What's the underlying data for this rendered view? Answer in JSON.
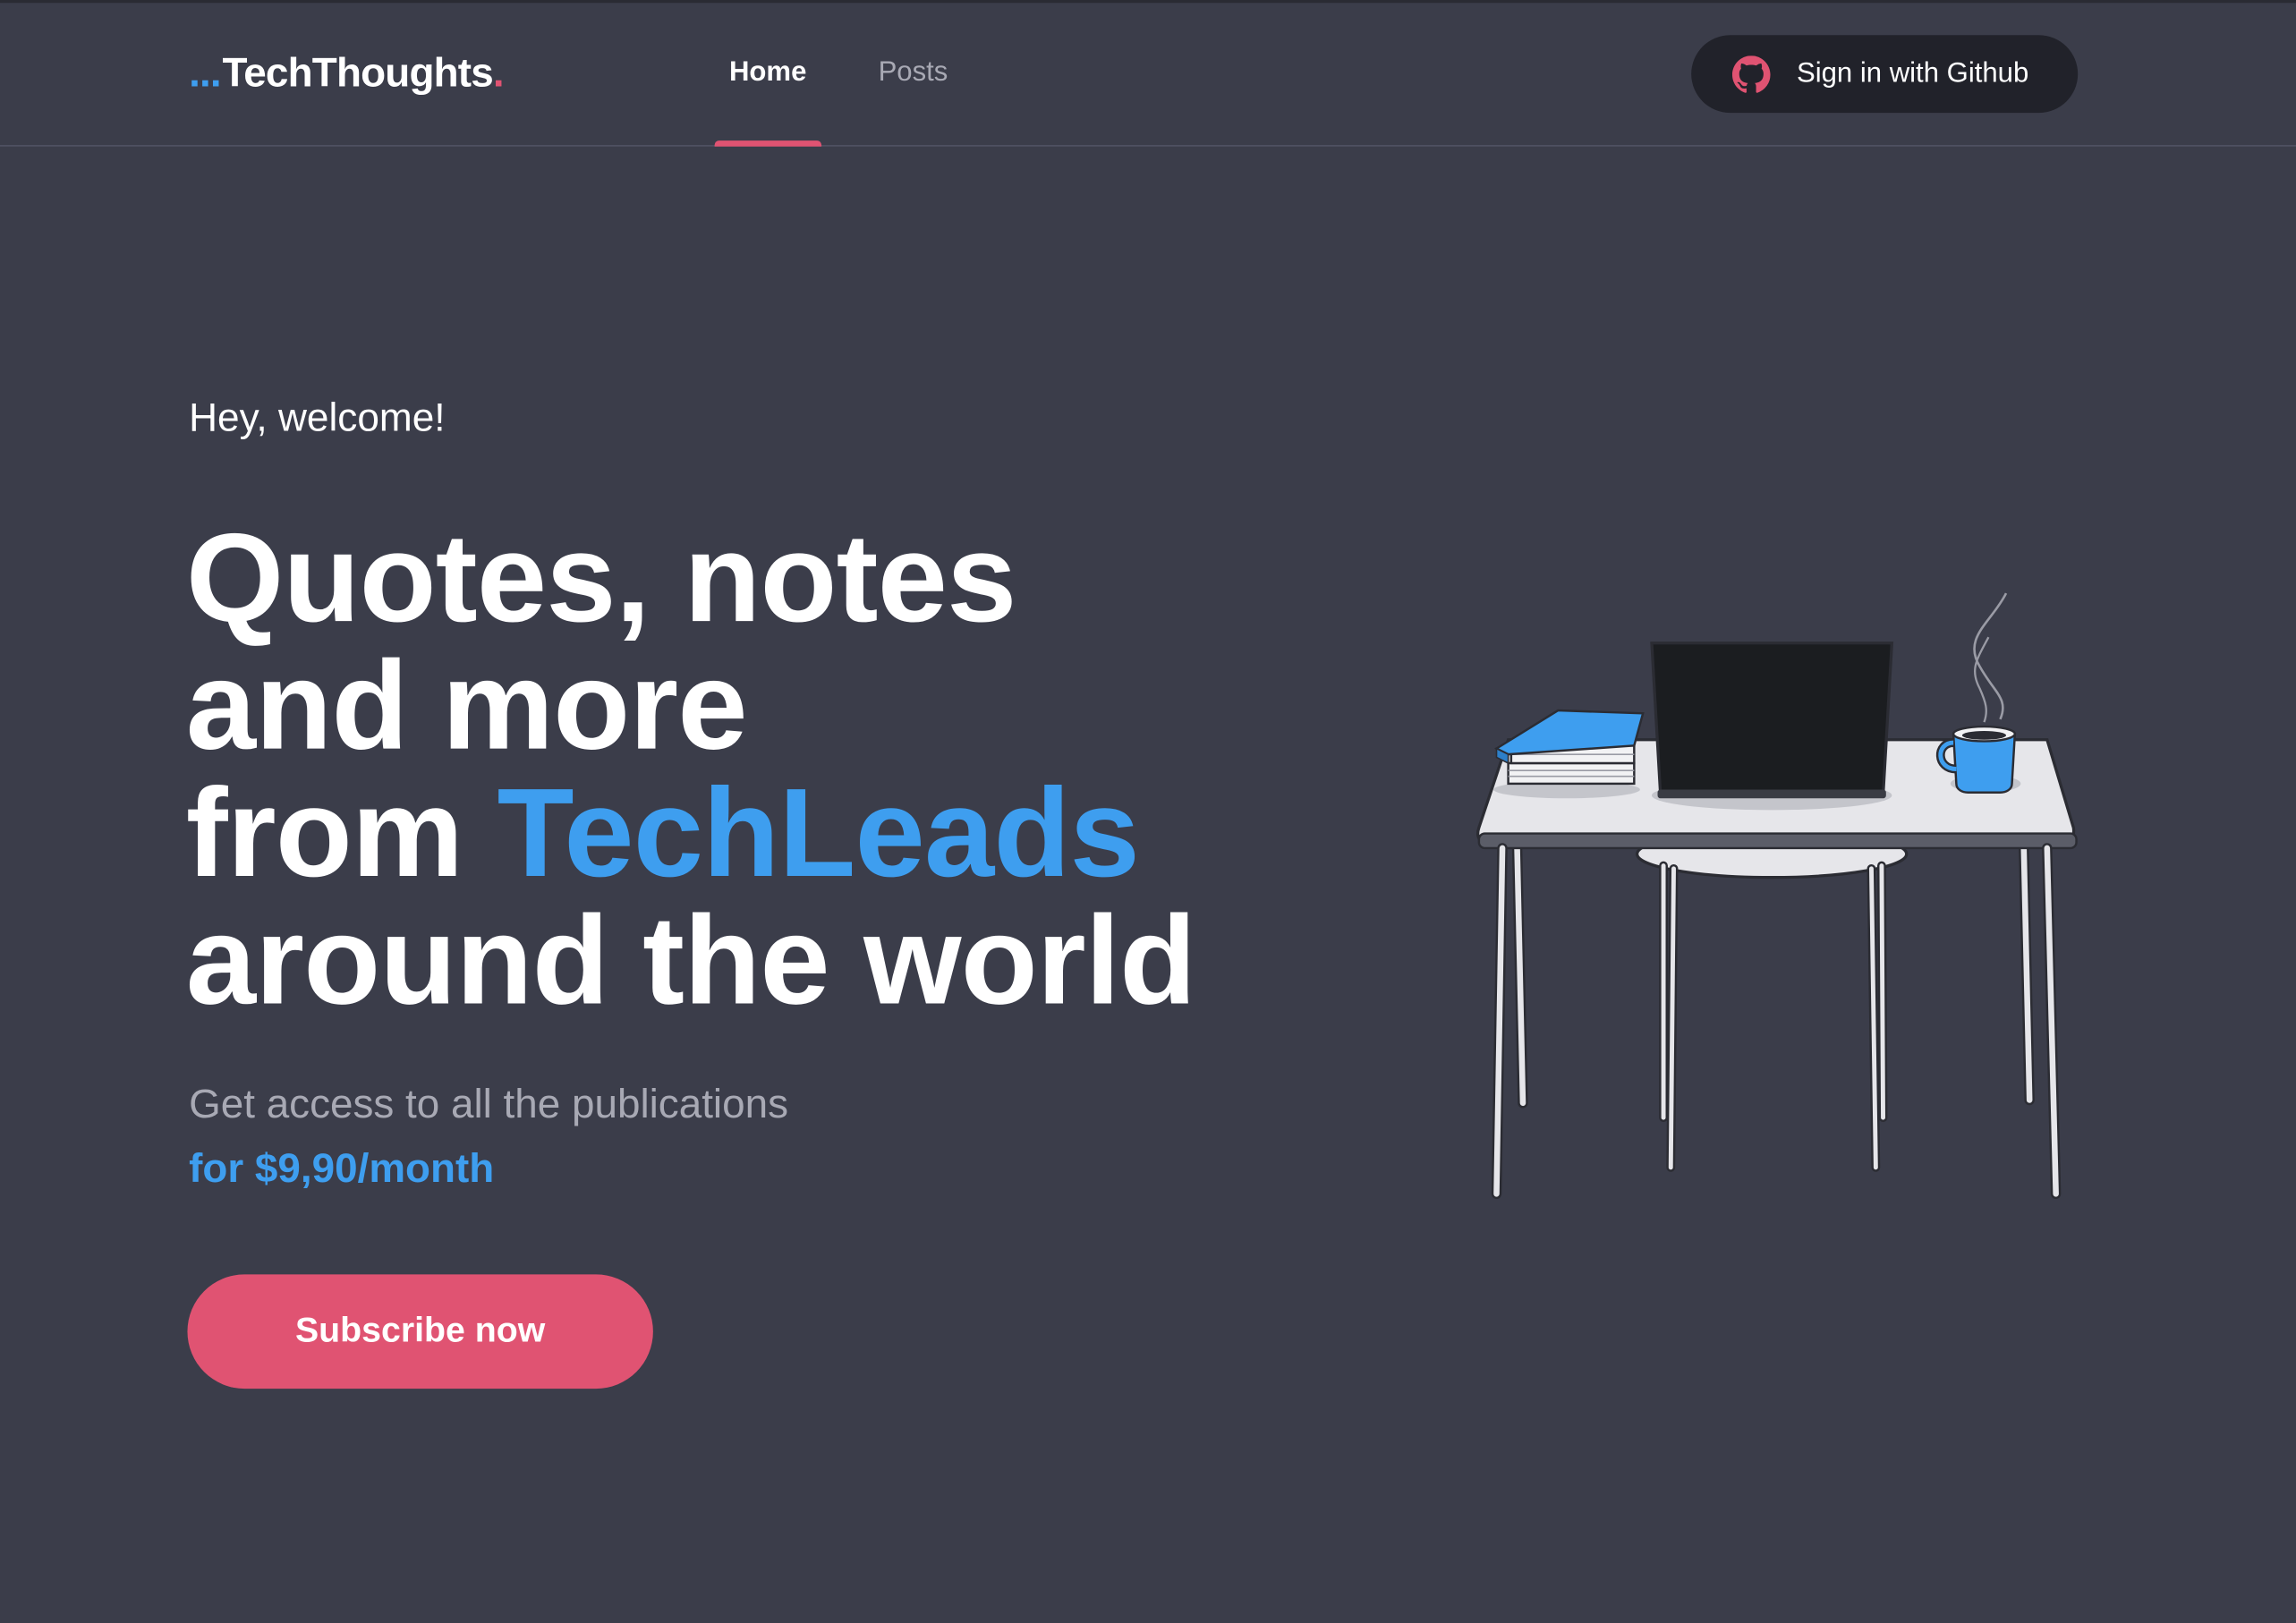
{
  "brand": {
    "prefix_dots": "...",
    "name": "TechThoughts",
    "suffix_dot": ".",
    "accent_color": "#3e9eef",
    "dot_color": "#e05372"
  },
  "nav": {
    "items": [
      {
        "label": "Home",
        "active": true
      },
      {
        "label": "Posts",
        "active": false
      }
    ]
  },
  "signin": {
    "label": "Sign in with Github",
    "icon": "github-icon"
  },
  "hero": {
    "greeting": "Hey, welcome!",
    "headline_line1": "Quotes, notes",
    "headline_line2": "and more",
    "headline_line3_prefix": "from ",
    "headline_line3_accent": "TechLeads",
    "headline_line4": "around the world",
    "subtitle": "Get access to all the publications",
    "price": "for $9,90/month",
    "cta_label": "Subscribe now"
  },
  "colors": {
    "background": "#3b3d4a",
    "primary": "#e05372",
    "accent": "#3e9eef",
    "muted_text": "#a8a9b4",
    "signin_bg": "#21222a"
  },
  "illustration": {
    "icon": "desk-with-laptop-books-coffee-illustration"
  }
}
